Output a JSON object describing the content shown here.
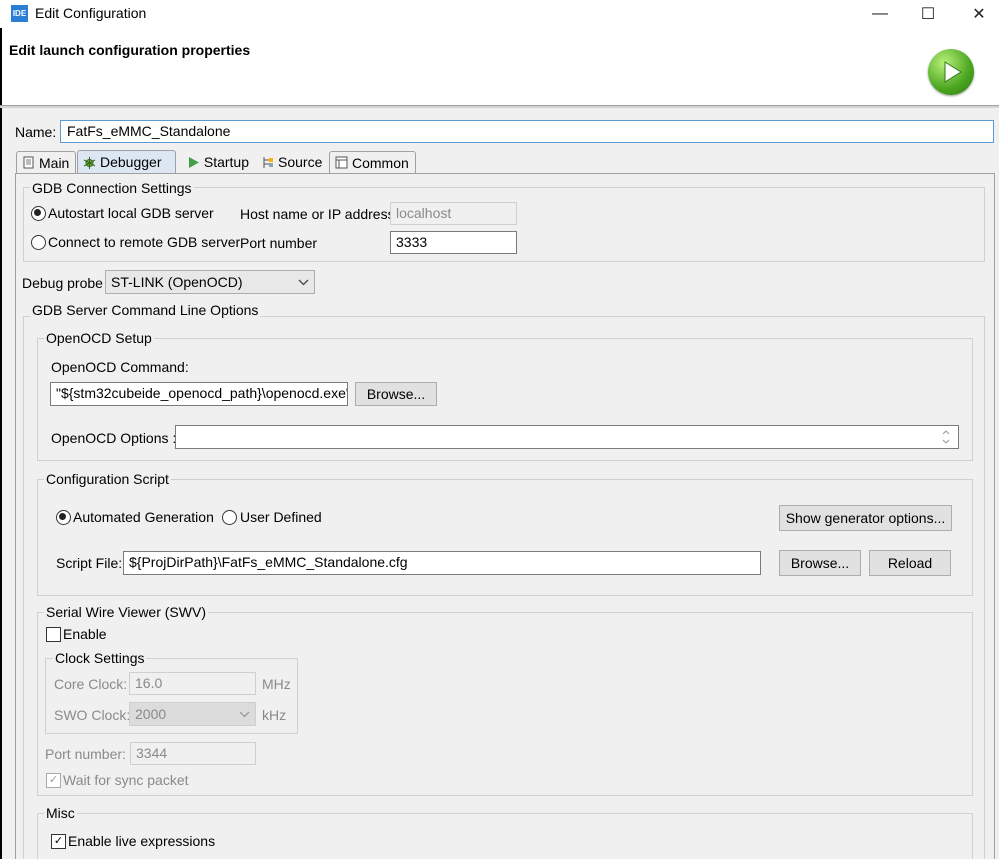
{
  "window": {
    "app_icon_text": "IDE",
    "title": "Edit Configuration",
    "minimize": "—",
    "maximize": "☐",
    "close": "✕"
  },
  "header": {
    "title": "Edit launch configuration properties"
  },
  "name": {
    "label": "Name:",
    "value": "FatFs_eMMC_Standalone"
  },
  "tabs": [
    {
      "label": "Main"
    },
    {
      "label": "Debugger"
    },
    {
      "label": "Startup"
    },
    {
      "label": "Source"
    },
    {
      "label": "Common"
    }
  ],
  "gdb": {
    "title": "GDB Connection Settings",
    "autostart_label": "Autostart local GDB server",
    "remote_label": "Connect to remote GDB server",
    "host_label": "Host name or IP address",
    "host_value": "localhost",
    "port_label": "Port number",
    "port_value": "3333"
  },
  "probe": {
    "label": "Debug probe",
    "value": "ST-LINK (OpenOCD)"
  },
  "server": {
    "title": "GDB Server Command Line Options",
    "setup_title": "OpenOCD Setup",
    "command_label": "OpenOCD Command:",
    "command_value": "\"${stm32cubeide_openocd_path}\\openocd.exe\"",
    "browse_label": "Browse...",
    "options_label": "OpenOCD Options :",
    "options_value": ""
  },
  "config_script": {
    "title": "Configuration Script",
    "automated_label": "Automated Generation",
    "user_label": "User Defined",
    "show_gen_label": "Show generator options...",
    "script_label": "Script File:",
    "script_value": "${ProjDirPath}\\FatFs_eMMC_Standalone.cfg",
    "browse_label": "Browse...",
    "reload_label": "Reload"
  },
  "swv": {
    "title": "Serial Wire Viewer (SWV)",
    "enable_label": "Enable",
    "clock_title": "Clock Settings",
    "core_label": "Core Clock:",
    "core_value": "16.0",
    "core_unit": "MHz",
    "swo_label": "SWO Clock:",
    "swo_value": "2000",
    "swo_unit": "kHz",
    "port_label": "Port number:",
    "port_value": "3344",
    "wait_label": "Wait for sync packet"
  },
  "misc": {
    "title": "Misc",
    "live_label": "Enable live expressions"
  }
}
